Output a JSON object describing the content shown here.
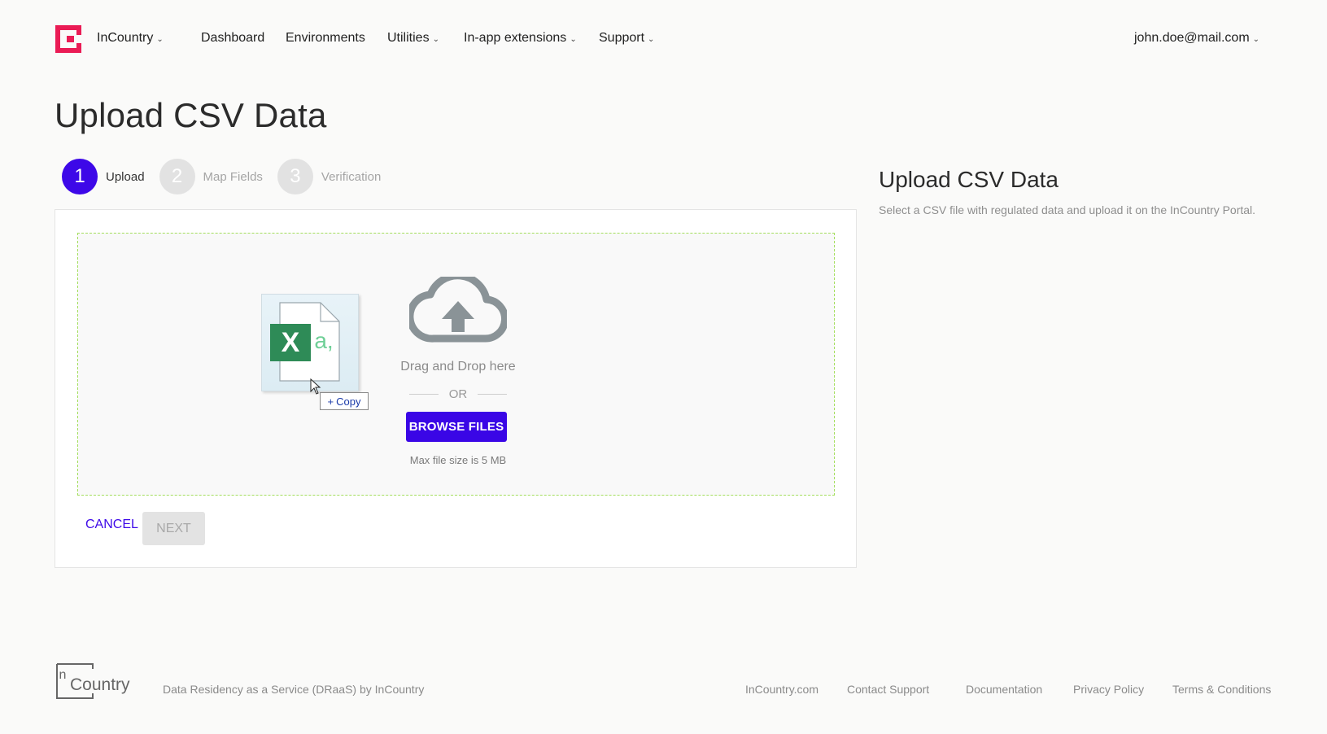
{
  "header": {
    "org": "InCountry",
    "nav": {
      "dashboard": "Dashboard",
      "environments": "Environments",
      "utilities": "Utilities",
      "extensions": "In-app extensions",
      "support": "Support"
    },
    "user": "john.doe@mail.com"
  },
  "page": {
    "title": "Upload CSV Data"
  },
  "stepper": {
    "steps": [
      {
        "number": "1",
        "label": "Upload",
        "state": "active"
      },
      {
        "number": "2",
        "label": "Map Fields",
        "state": "inactive"
      },
      {
        "number": "3",
        "label": "Verification",
        "state": "inactive"
      }
    ]
  },
  "dropzone": {
    "drag_text": "Drag and Drop here",
    "or_text": "OR",
    "browse_label": "BROWSE FILES",
    "max_size": "Max file size is 5 MB",
    "drag_file": {
      "glyph": "X",
      "ext": "a,",
      "copy_label": "Copy"
    }
  },
  "actions": {
    "cancel": "CANCEL",
    "next": "NEXT"
  },
  "side": {
    "title": "Upload CSV Data",
    "description": "Select a CSV file with regulated data and upload it on the InCountry Portal."
  },
  "footer": {
    "logo_top": "In",
    "logo_bottom": "Country",
    "tagline": "Data Residency as a Service (DRaaS) by InCountry",
    "links": {
      "site": "InCountry.com",
      "contact": "Contact Support",
      "docs": "Documentation",
      "privacy": "Privacy Policy",
      "terms": "Terms & Conditions"
    }
  },
  "colors": {
    "accent": "#3d08e8",
    "brand_red": "#ea1b55",
    "dropzone_border": "#a3de5c",
    "excel_green": "#2e8b57"
  }
}
